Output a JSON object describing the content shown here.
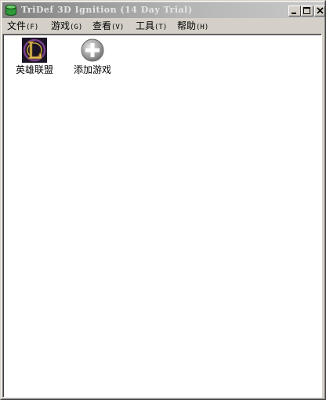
{
  "window": {
    "title": "TriDef 3D Ignition (14 Day Trial)",
    "buttons": {
      "minimize": "minimize",
      "maximize": "maximize",
      "close": "close"
    }
  },
  "menu": {
    "items": [
      {
        "label": "文件",
        "accel": "(F)"
      },
      {
        "label": "游戏",
        "accel": "(G)"
      },
      {
        "label": "查看",
        "accel": "(V)"
      },
      {
        "label": "工具",
        "accel": "(T)"
      },
      {
        "label": "帮助",
        "accel": "(H)"
      }
    ]
  },
  "games": [
    {
      "label": "英雄联盟",
      "icon": "league-of-legends-icon"
    },
    {
      "label": "添加游戏",
      "icon": "add-game-icon"
    }
  ],
  "colors": {
    "chrome": "#d4d0c8",
    "title_gradient_start": "#808080",
    "client_bg": "#ffffff",
    "app_icon_green": "#2e9a3a"
  }
}
